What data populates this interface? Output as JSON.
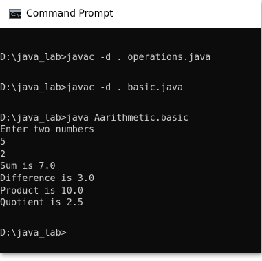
{
  "window": {
    "title": "Command Prompt",
    "icon": "command-prompt-icon",
    "icon_text": "C:\\."
  },
  "console": {
    "lines": [
      "",
      "D:\\java_lab>javac -d . operations.java",
      "",
      "D:\\java_lab>javac -d . basic.java",
      "",
      "D:\\java_lab>java Aarithmetic.basic",
      "Enter two numbers",
      "5",
      "2",
      "Sum is 7.0",
      "Difference is 3.0",
      "Product is 10.0",
      "Quotient is 2.5",
      "",
      "D:\\java_lab>"
    ]
  },
  "colors": {
    "console_background": "#0c0c0c",
    "console_text": "#cccccc",
    "titlebar_background": "#ffffff"
  }
}
